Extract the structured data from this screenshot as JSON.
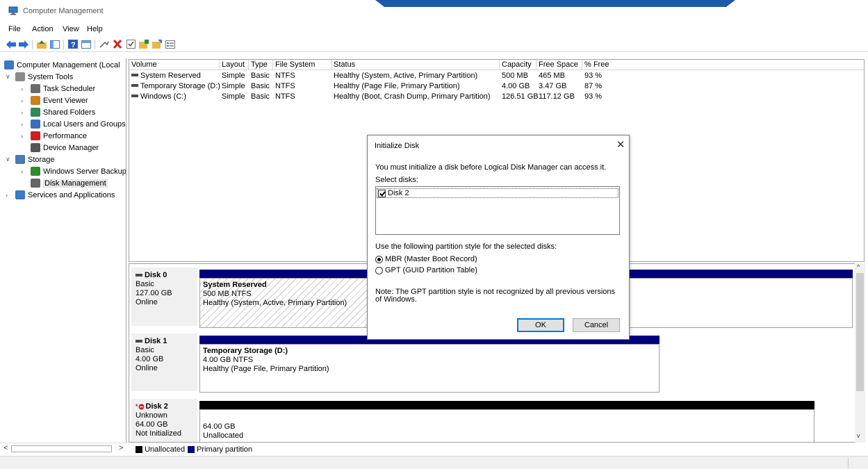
{
  "window": {
    "title": "Computer Management"
  },
  "menu": [
    "File",
    "Action",
    "View",
    "Help"
  ],
  "tree": {
    "items": [
      {
        "label": "Computer Management (Local",
        "level": 0,
        "chev": "",
        "icon": "computer-management-icon"
      },
      {
        "label": "System Tools",
        "level": 1,
        "chev": "v",
        "icon": "system-tools-icon"
      },
      {
        "label": "Task Scheduler",
        "level": 2,
        "chev": ">",
        "icon": "task-scheduler-icon"
      },
      {
        "label": "Event Viewer",
        "level": 2,
        "chev": ">",
        "icon": "event-viewer-icon"
      },
      {
        "label": "Shared Folders",
        "level": 2,
        "chev": ">",
        "icon": "shared-folders-icon"
      },
      {
        "label": "Local Users and Groups",
        "level": 2,
        "chev": ">",
        "icon": "users-icon"
      },
      {
        "label": "Performance",
        "level": 2,
        "chev": ">",
        "icon": "performance-icon"
      },
      {
        "label": "Device Manager",
        "level": 2,
        "chev": "",
        "icon": "device-manager-icon"
      },
      {
        "label": "Storage",
        "level": 1,
        "chev": "v",
        "icon": "storage-icon"
      },
      {
        "label": "Windows Server Backup",
        "level": 2,
        "chev": ">",
        "icon": "backup-icon"
      },
      {
        "label": "Disk Management",
        "level": 2,
        "chev": "",
        "icon": "disk-management-icon",
        "selected": true
      },
      {
        "label": "Services and Applications",
        "level": 1,
        "chev": ">",
        "icon": "services-icon"
      }
    ]
  },
  "volumes": {
    "headers": [
      "Volume",
      "Layout",
      "Type",
      "File System",
      "Status",
      "Capacity",
      "Free Space",
      "% Free"
    ],
    "rows": [
      [
        "System Reserved",
        "Simple",
        "Basic",
        "NTFS",
        "Healthy (System, Active, Primary Partition)",
        "500 MB",
        "465 MB",
        "93 %"
      ],
      [
        "Temporary Storage (D:)",
        "Simple",
        "Basic",
        "NTFS",
        "Healthy (Page File, Primary Partition)",
        "4.00 GB",
        "3.47 GB",
        "87 %"
      ],
      [
        "Windows (C:)",
        "Simple",
        "Basic",
        "NTFS",
        "Healthy (Boot, Crash Dump, Primary Partition)",
        "126.51 GB",
        "117.12 GB",
        "93 %"
      ]
    ]
  },
  "disks": [
    {
      "name": "Disk 0",
      "type": "Basic",
      "size": "127.00 GB",
      "state": "Online",
      "partition": {
        "name": "System Reserved",
        "size": "500 MB NTFS",
        "status": "Healthy (System, Active, Primary Partition)"
      }
    },
    {
      "name": "Disk 1",
      "type": "Basic",
      "size": "4.00 GB",
      "state": "Online",
      "partition": {
        "name": "Temporary Storage  (D:)",
        "size": "4.00 GB NTFS",
        "status": "Healthy (Page File, Primary Partition)"
      }
    },
    {
      "name": "Disk 2",
      "prefix": "*",
      "type": "Unknown",
      "size": "64.00 GB",
      "state": "Not Initialized",
      "partition": {
        "name": "",
        "size": "64.00 GB",
        "status": "Unallocated"
      }
    }
  ],
  "legend": {
    "unallocated": "Unallocated",
    "primary": "Primary partition"
  },
  "colors": {
    "primary": "#00007f",
    "unallocated": "#000000",
    "selection": "#e5e5e5"
  },
  "dialog": {
    "title": "Initialize Disk",
    "message": "You must initialize a disk before Logical Disk Manager can access it.",
    "select_label": "Select disks:",
    "disk_item": "Disk 2",
    "style_label": "Use the following partition style for the selected disks:",
    "mbr": "MBR (Master Boot Record)",
    "gpt": "GPT (GUID Partition Table)",
    "note": "Note: The GPT partition style is not recognized by all previous versions of Windows.",
    "ok": "OK",
    "cancel": "Cancel",
    "close": "✕"
  }
}
